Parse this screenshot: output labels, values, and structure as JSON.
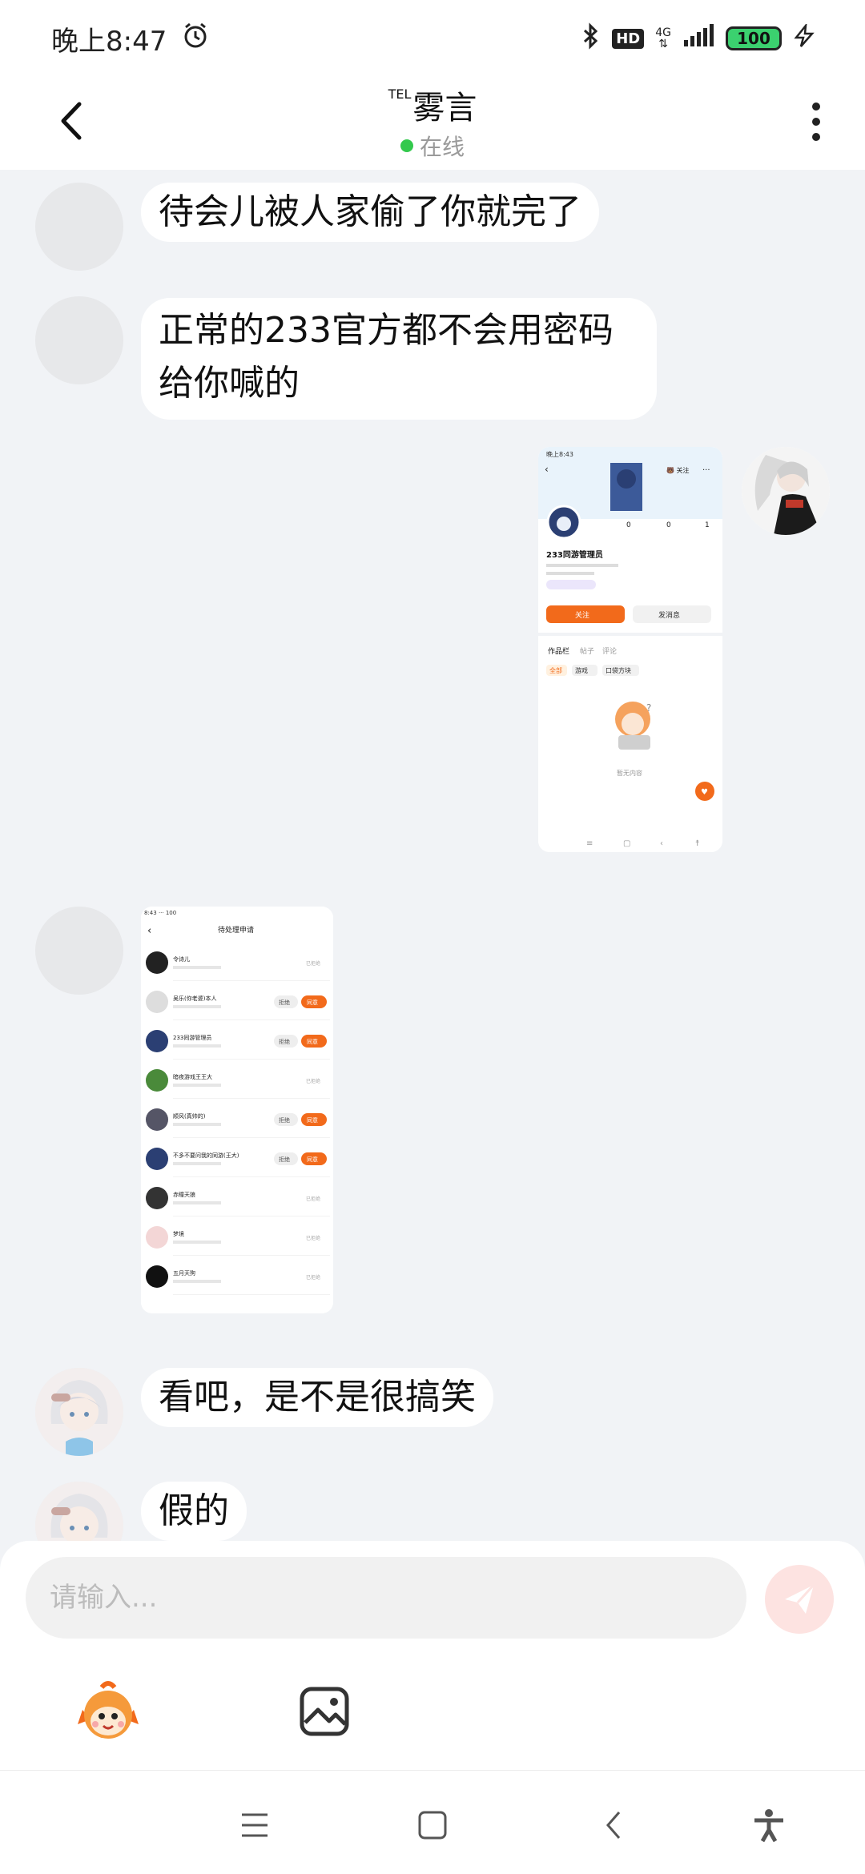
{
  "status_bar": {
    "time": "晚上8:47",
    "hd": "HD",
    "network": "4G",
    "battery": "100"
  },
  "header": {
    "prefix": "TEL",
    "title": "雾言",
    "status": "在线"
  },
  "messages": [
    {
      "side": "left",
      "type": "text",
      "text": "待会儿被人家偷了你就完了"
    },
    {
      "side": "left",
      "type": "text",
      "text": "正常的233官方都不会用密码给你喊的"
    },
    {
      "side": "right",
      "type": "image"
    },
    {
      "side": "left",
      "type": "image"
    },
    {
      "side": "left",
      "type": "text",
      "text": "看吧，是不是很搞笑"
    },
    {
      "side": "left",
      "type": "text",
      "text": "假的"
    }
  ],
  "shot1": {
    "time": "晚上8:43",
    "name": "233同游管理员",
    "counts": [
      "0",
      "0",
      "1"
    ],
    "follow": "关注",
    "message": "发消息",
    "tabs": [
      "作品栏",
      "帖子",
      "评论"
    ],
    "filters": [
      "全部",
      "游戏",
      "口袋方块"
    ],
    "empty": "暂无内容"
  },
  "shot2": {
    "title": "待处理申请",
    "rows": [
      {
        "name": "令诗儿",
        "action": "已拒绝"
      },
      {
        "name": "吴乐(你老婆)本人",
        "action": "buttons"
      },
      {
        "name": "233同游管理员",
        "action": "buttons"
      },
      {
        "name": "暗夜游戏王王大",
        "action": "已拒绝"
      },
      {
        "name": "顺风(真帅的)",
        "action": "buttons"
      },
      {
        "name": "不多不要问我的同游(王大)",
        "action": "buttons"
      },
      {
        "name": "赤瞳天狼",
        "action": "已拒绝"
      },
      {
        "name": "梦境",
        "action": "已拒绝"
      },
      {
        "name": "五月天狗",
        "action": "已拒绝"
      }
    ],
    "reject": "拒绝",
    "accept": "同意"
  },
  "input": {
    "placeholder": "请输入..."
  },
  "colors": {
    "accent": "#f26a1b",
    "online": "#33c94d",
    "send_bg": "#fde3e1"
  }
}
